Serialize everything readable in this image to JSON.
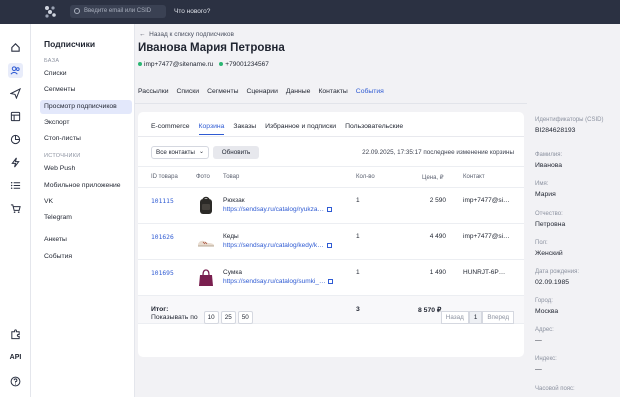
{
  "topbar": {
    "search_placeholder": "Введите email или CSID",
    "whats_new": "Что нового?"
  },
  "rail": {
    "icons": [
      "home-icon",
      "users-icon",
      "send-icon",
      "layout-icon",
      "chart-icon",
      "bolt-icon",
      "list-icon",
      "cart-icon"
    ],
    "bottom": [
      "puzzle-icon",
      "api",
      "help-icon"
    ],
    "api_label": "API"
  },
  "sidebar": {
    "title": "Подписчики",
    "section_base": "БАЗА",
    "items_base": [
      "Списки",
      "Сегменты",
      "Просмотр подписчиков",
      "Экспорт",
      "Стоп-листы"
    ],
    "section_sources": "ИСТОЧНИКИ",
    "items_sources": [
      "Web Push",
      "Мобильное приложение",
      "VK",
      "Telegram"
    ],
    "items_other": [
      "Анкеты",
      "События"
    ]
  },
  "profile": {
    "back_link": "Назад к списку подписчиков",
    "name": "Иванова Мария Петровна",
    "email": "imp+7477@sitename.ru",
    "phone": "+79001234567",
    "tabs": [
      "Рассылки",
      "Списки",
      "Сегменты",
      "Сценарии",
      "Данные",
      "Контакты",
      "События"
    ],
    "active_tab": "События"
  },
  "events": {
    "subtabs": [
      "E-commerce",
      "Корзина",
      "Заказы",
      "Избранное и подписки",
      "Пользовательские"
    ],
    "active_subtab": "Корзина",
    "filter_value": "Все контакты",
    "refresh_label": "Обновить",
    "last_change": "22.09.2025, 17:35:17 последнее изменение корзины",
    "columns": {
      "id": "ID товара",
      "photo": "Фото",
      "product": "Товар",
      "qty": "Кол-во",
      "price": "Цена, ₽",
      "contact": "Контакт"
    },
    "rows": [
      {
        "id": "101115",
        "name": "Рюкзак",
        "url": "https://sendsay.ru/catalog/ryukza…",
        "qty": "1",
        "price": "2 590",
        "contact": "imp+7477@si…",
        "photo_color": "#2b2a27"
      },
      {
        "id": "101626",
        "name": "Кеды",
        "url": "https://sendsay.ru/catalog/kedy/k…",
        "qty": "1",
        "price": "4 490",
        "contact": "imp+7477@si…",
        "photo_color": "#e8dcd0"
      },
      {
        "id": "101695",
        "name": "Сумка",
        "url": "https://sendsay.ru/catalog/sumki_…",
        "qty": "1",
        "price": "1 490",
        "contact": "HUNRJT-6P…",
        "photo_color": "#7a1f4f"
      }
    ],
    "total_label": "Итог:",
    "total_qty": "3",
    "total_price": "8 570 ₽",
    "show_by_label": "Показывать по",
    "page_sizes": [
      "10",
      "25",
      "50"
    ],
    "prev": "Назад",
    "current_page": "1",
    "next": "Вперед"
  },
  "details": [
    {
      "label": "Идентификаторы (CSID)",
      "value": "BI284628193"
    },
    {
      "label": "Фамилия:",
      "value": "Иванова"
    },
    {
      "label": "Имя:",
      "value": "Мария"
    },
    {
      "label": "Отчество:",
      "value": "Петровна"
    },
    {
      "label": "Пол:",
      "value": "Женский"
    },
    {
      "label": "Дата рождения:",
      "value": "02.09.1985"
    },
    {
      "label": "Город:",
      "value": "Москва"
    },
    {
      "label": "Адрес:",
      "value": "—"
    },
    {
      "label": "Индекс:",
      "value": "—"
    },
    {
      "label": "Часовой пояс:",
      "value": ""
    }
  ]
}
